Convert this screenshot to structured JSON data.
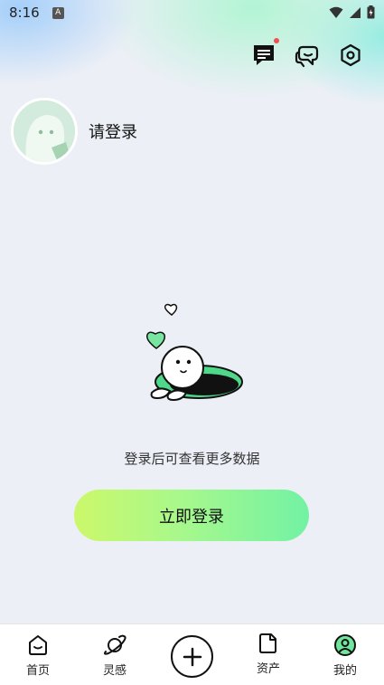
{
  "status_bar": {
    "time": "8:16",
    "badge": "A"
  },
  "profile": {
    "login_prompt": "请登录"
  },
  "empty_state": {
    "hint": "登录后可查看更多数据"
  },
  "login_button": {
    "label": "立即登录"
  },
  "bottom_nav": {
    "items": [
      {
        "label": "首页",
        "icon": "home-icon"
      },
      {
        "label": "灵感",
        "icon": "planet-icon"
      },
      {
        "label": "",
        "icon": "plus-icon"
      },
      {
        "label": "资产",
        "icon": "document-icon"
      },
      {
        "label": "我的",
        "icon": "profile-icon",
        "active": true
      }
    ]
  },
  "colors": {
    "accent_green": "#72f2a4",
    "accent_lime": "#ccf86a",
    "notification_dot": "#f05050",
    "background": "#eceff6"
  }
}
